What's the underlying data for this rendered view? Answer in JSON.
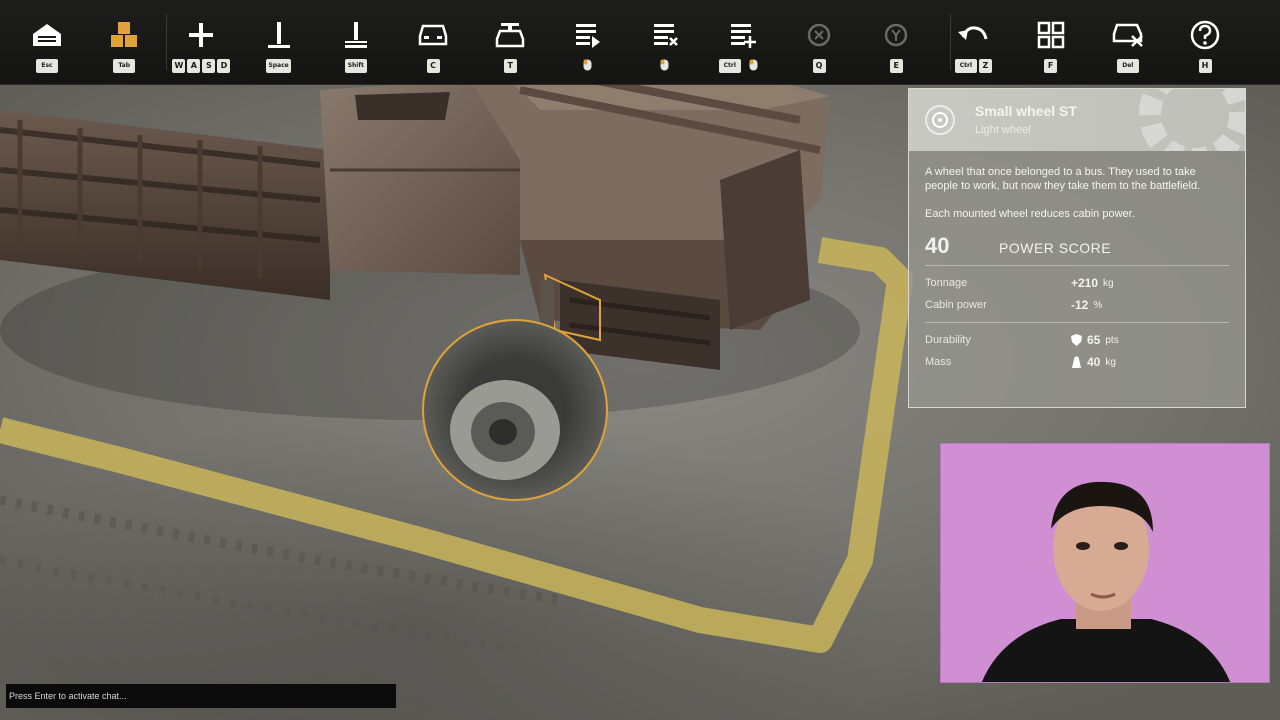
{
  "toolbar": {
    "tools": [
      {
        "id": "garage",
        "icon": "garage-icon",
        "keys": [
          "Esc"
        ],
        "active": false,
        "dim": false
      },
      {
        "id": "parts",
        "icon": "parts-crates-icon",
        "keys": [
          "Tab"
        ],
        "active": true,
        "dim": false
      },
      {
        "id": "move",
        "icon": "move-cross-icon",
        "keys": [
          "W",
          "A",
          "S",
          "D"
        ],
        "active": false,
        "dim": false
      },
      {
        "id": "raise",
        "icon": "raise-part-icon",
        "keys": [
          "Space"
        ],
        "active": false,
        "dim": false
      },
      {
        "id": "lower",
        "icon": "lower-part-icon",
        "keys": [
          "Shift"
        ],
        "active": false,
        "dim": false
      },
      {
        "id": "camera",
        "icon": "vehicle-front-icon",
        "keys": [
          "C"
        ],
        "active": false,
        "dim": false
      },
      {
        "id": "test",
        "icon": "test-drive-icon",
        "keys": [
          "T"
        ],
        "active": false,
        "dim": false
      },
      {
        "id": "list-select",
        "icon": "list-select-icon",
        "keys": [
          "mouse"
        ],
        "active": false,
        "dim": false
      },
      {
        "id": "list-remove",
        "icon": "list-remove-icon",
        "keys": [
          "mouse"
        ],
        "active": false,
        "dim": false
      },
      {
        "id": "list-add",
        "icon": "list-add-icon",
        "keys": [
          "Ctrl",
          "mouse"
        ],
        "active": false,
        "dim": false
      },
      {
        "id": "rotate-left",
        "icon": "rotate-left-icon",
        "keys": [
          "Q"
        ],
        "active": false,
        "dim": true
      },
      {
        "id": "rotate-right",
        "icon": "rotate-right-icon",
        "keys": [
          "E"
        ],
        "active": false,
        "dim": true
      },
      {
        "id": "undo",
        "icon": "undo-icon",
        "keys": [
          "Ctrl",
          "Z"
        ],
        "active": false,
        "dim": false
      },
      {
        "id": "grid",
        "icon": "grid-icon",
        "keys": [
          "F"
        ],
        "active": false,
        "dim": false
      },
      {
        "id": "delete-vehicle",
        "icon": "delete-vehicle-icon",
        "keys": [
          "Del"
        ],
        "active": false,
        "dim": false
      },
      {
        "id": "help",
        "icon": "help-icon",
        "keys": [
          "H"
        ],
        "active": false,
        "dim": false
      }
    ]
  },
  "panel": {
    "title": "Small wheel ST",
    "subtitle": "Light wheel",
    "description": "A wheel that once belonged to a bus. They used to take people to work, but now they take them to the battlefield.",
    "note": "Each mounted wheel reduces cabin power.",
    "power_score": "40",
    "power_label": "POWER SCORE",
    "stats_main": [
      {
        "name": "Tonnage",
        "value": "+210",
        "unit": "kg"
      },
      {
        "name": "Cabin power",
        "value": "-12",
        "unit": "%"
      }
    ],
    "stats_extra": [
      {
        "name": "Durability",
        "value": "65",
        "unit": "pts",
        "icon": "shield-icon"
      },
      {
        "name": "Mass",
        "value": "40",
        "unit": "kg",
        "icon": "weight-icon"
      }
    ]
  },
  "chat": {
    "placeholder": "Press Enter to activate chat..."
  },
  "colors": {
    "toolbar_bg": "#181816",
    "accent": "#e0a23a",
    "panel_bg": "#96968f",
    "webcam_bg": "#cf8fd2"
  }
}
